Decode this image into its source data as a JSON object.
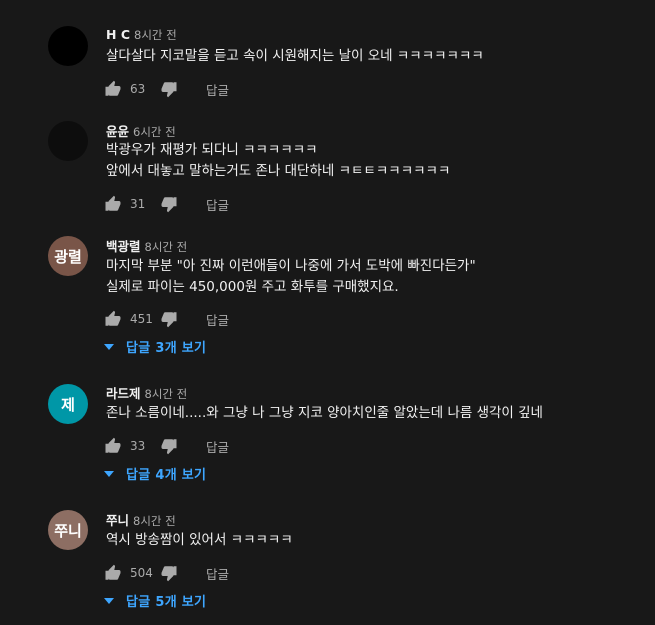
{
  "comments": [
    {
      "author": "H C",
      "time": "8시간 전",
      "avatar_text": "",
      "avatar_color": "#000000",
      "lines": [
        "살다살다 지코말을 듣고 속이 시원해지는 날이 오네 ㅋㅋㅋㅋㅋㅋㅋ"
      ],
      "likes": "63",
      "reply_label": "답글",
      "replies": ""
    },
    {
      "author": "윤윤",
      "time": "6시간 전",
      "avatar_text": "",
      "avatar_color": "#0d0d0d",
      "lines": [
        "박광우가 재평가 되다니 ㅋㅋㅋㅋㅋㅋ",
        "앞에서 대놓고 말하는거도 존나 대단하네 ㅋㅌㅌㅋㅋㅋㅋㅋㅋ"
      ],
      "likes": "31",
      "reply_label": "답글",
      "replies": ""
    },
    {
      "author": "백광렬",
      "time": "8시간 전",
      "avatar_text": "광렬",
      "avatar_color": "#795548",
      "lines": [
        "마지막 부분 \"아 진짜 이런애들이 나중에 가서 도박에 빠진다든가\"",
        "실제로 파이는 450,000원 주고 화투를 구매했지요."
      ],
      "likes": "451",
      "reply_label": "답글",
      "replies": "답글 3개 보기"
    },
    {
      "author": "라드제",
      "time": "8시간 전",
      "avatar_text": "제",
      "avatar_color": "#0097a7",
      "lines": [
        "존나 소름이네.....와 그냥 나 그냥 지코 양아치인줄 알았는데 나름 생각이 깊네"
      ],
      "likes": "33",
      "reply_label": "답글",
      "replies": "답글 4개 보기"
    },
    {
      "author": "쭈니",
      "time": "8시간 전",
      "avatar_text": "쭈니",
      "avatar_color": "#8d6e63",
      "lines": [
        "역시 방송짬이 있어서 ㅋㅋㅋㅋㅋ"
      ],
      "likes": "504",
      "reply_label": "답글",
      "replies": "답글 5개 보기"
    }
  ]
}
